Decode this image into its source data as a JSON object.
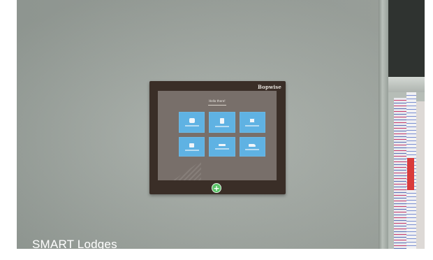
{
  "caption": "SMART Lodges",
  "panel": {
    "brand": "Bopwise",
    "greeting": "Hello there!",
    "tiles": [
      {
        "icon": "chat-icon"
      },
      {
        "icon": "door-icon"
      },
      {
        "icon": "window-icon"
      },
      {
        "icon": "box-icon"
      },
      {
        "icon": "bar-icon"
      },
      {
        "icon": "plane-icon"
      }
    ],
    "plus_button": "+"
  },
  "colors": {
    "wall": "#a3aaa4",
    "panel_frame": "#3a2e27",
    "screen": "#786f6a",
    "tile": "#5fb2e3",
    "plus_button": "#5cc46a",
    "caption": "#ffffff"
  }
}
